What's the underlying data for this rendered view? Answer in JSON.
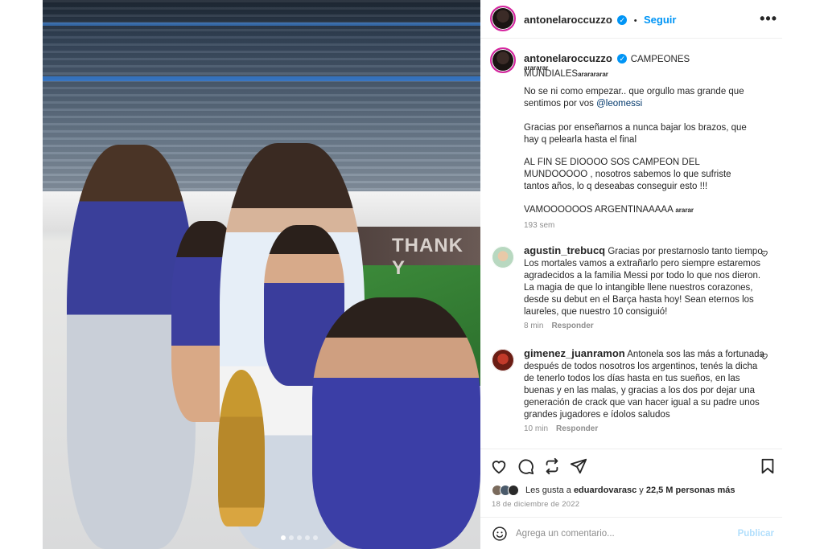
{
  "photo": {
    "board_text": "THANK Y",
    "slide_count": 5,
    "current_slide": 1
  },
  "header": {
    "username": "antonelaroccuzzo",
    "separator": "•",
    "follow_label": "Seguir",
    "more_label": "•••"
  },
  "caption": {
    "username": "antonelaroccuzzo",
    "title": "CAMPEONES MUNDIALES",
    "title_suffix": "ararararar",
    "second_line": "arararar",
    "p1_text": "No se ni como empezar.. que orgullo mas grande que sentimos por vos ",
    "p1_mention": "@leomessi",
    "p2": "Gracias por enseñarnos a nunca bajar los brazos, que hay q pelearla hasta el final",
    "p3": "AL FIN SE DIOOOO SOS CAMPEON DEL MUNDOOOOO , nosotros sabemos lo que sufriste tantos años, lo q deseabas conseguir esto !!!",
    "p4": "VAMOOOOOOS ARGENTINAAAAA",
    "p4_suffix": "ararar",
    "time": "193 sem"
  },
  "comments": [
    {
      "username": "agustin_trebucq",
      "text": "Gracias por prestarnoslo tanto tiempo. Los mortales vamos a extrañarlo pero siempre estaremos agradecidos a la familia Messi por todo lo que nos dieron. La magia de que lo intangible llene nuestros corazones, desde su debut en el Barça hasta hoy! Sean eternos los laureles, que nuestro 10 consiguió!",
      "time": "8 min",
      "reply": "Responder"
    },
    {
      "username": "gimenez_juanramon",
      "text": "Antonela sos las más a fortunada después de todos nosotros los argentinos, tenés la dicha de tenerlo todos los días hasta en tus sueños, en las buenas y en las malas, y gracias a los dos por dejar una generación de crack que van hacer igual a su padre unos grandes jugadores e ídolos saludos",
      "time": "10 min",
      "reply": "Responder"
    }
  ],
  "actions": {
    "likes_prefix": "Les gusta a ",
    "likes_user": "eduardovarasc",
    "likes_and": " y ",
    "likes_count": "22,5 M personas más",
    "date": "18 de diciembre de 2022"
  },
  "add_comment": {
    "placeholder": "Agrega un comentario...",
    "publish_label": "Publicar"
  },
  "colors": {
    "accent": "#0095f6",
    "mention": "#00376b",
    "muted": "#8e8e8e",
    "publish_disabled": "#b2dffc"
  }
}
